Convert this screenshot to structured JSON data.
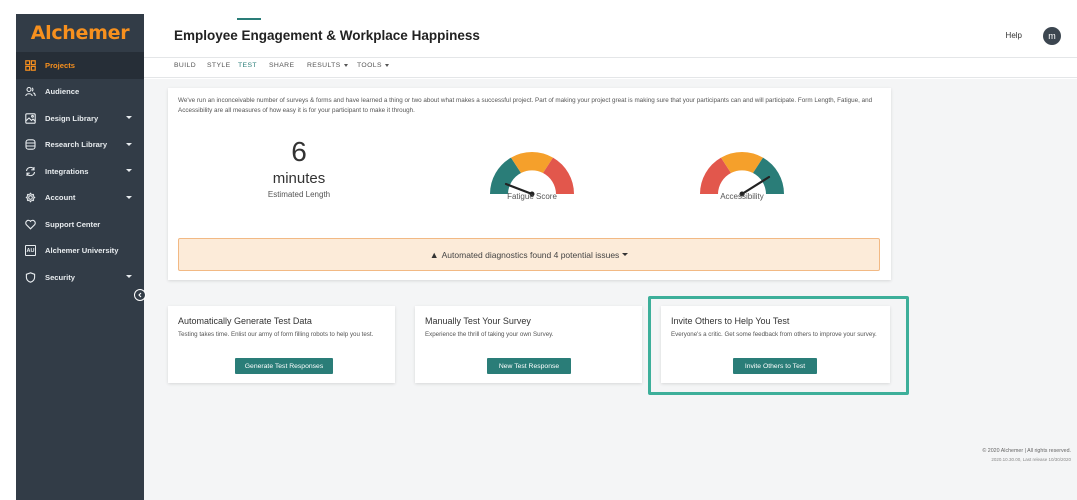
{
  "app": {
    "logo": "Alchemer"
  },
  "sidebar": {
    "items": [
      {
        "label": "Projects",
        "icon": "grid-icon",
        "active": true,
        "caret": false
      },
      {
        "label": "Audience",
        "icon": "users-icon",
        "active": false,
        "caret": false
      },
      {
        "label": "Design Library",
        "icon": "image-icon",
        "active": false,
        "caret": true
      },
      {
        "label": "Research Library",
        "icon": "database-icon",
        "active": false,
        "caret": true
      },
      {
        "label": "Integrations",
        "icon": "refresh-icon",
        "active": false,
        "caret": true
      },
      {
        "label": "Account",
        "icon": "gear-icon",
        "active": false,
        "caret": true
      },
      {
        "label": "Support Center",
        "icon": "heart-icon",
        "active": false,
        "caret": false
      },
      {
        "label": "Alchemer University",
        "icon": "au-icon",
        "active": false,
        "caret": false,
        "icon_text": "AU"
      },
      {
        "label": "Security",
        "icon": "shield-icon",
        "active": false,
        "caret": true
      }
    ]
  },
  "header": {
    "title": "Employee Engagement & Workplace Happiness",
    "help": "Help",
    "avatar": "m"
  },
  "tabs": {
    "items": [
      {
        "label": "BUILD"
      },
      {
        "label": "STYLE"
      },
      {
        "label": "TEST",
        "active": true
      },
      {
        "label": "SHARE"
      },
      {
        "label": "RESULTS",
        "dropdown": true
      },
      {
        "label": "TOOLS",
        "dropdown": true
      }
    ]
  },
  "main": {
    "intro": "We've run an inconceivable number of surveys & forms and have learned a thing or two about what makes a successful project. Part of making your project great is making sure that your participants can and will participate. Form Length, Fatigue, and Accessibility are all measures of how easy it is for your participant to make it through.",
    "length_value": "6",
    "length_unit": "minutes",
    "length_label": "Estimated Length",
    "fatigue_label": "Fatigue Score",
    "accessibility_label": "Accessibility",
    "banner_text": "Automated diagnostics found 4 potential issues",
    "colors": {
      "gauge_red": "#e2574c",
      "gauge_orange": "#f5a02b",
      "gauge_teal": "#2a7d78",
      "banner_bg": "#fcebd9",
      "accent": "#2a7d78"
    }
  },
  "cards": [
    {
      "title": "Automatically Generate Test Data",
      "desc": "Testing takes time. Enlist our army of form filling robots to help you test.",
      "button": "Generate Test Responses"
    },
    {
      "title": "Manually Test Your Survey",
      "desc": "Experience the thrill of taking your own Survey.",
      "button": "New Test Response"
    },
    {
      "title": "Invite Others to Help You Test",
      "desc": "Everyone's a critic. Get some feedback from others to improve your survey.",
      "button": "Invite Others to Test"
    }
  ],
  "footer": {
    "line1": "© 2020 Alchemer | All rights reserved.",
    "line2": "2020.10.30.00, Last release 10/30/2020"
  }
}
